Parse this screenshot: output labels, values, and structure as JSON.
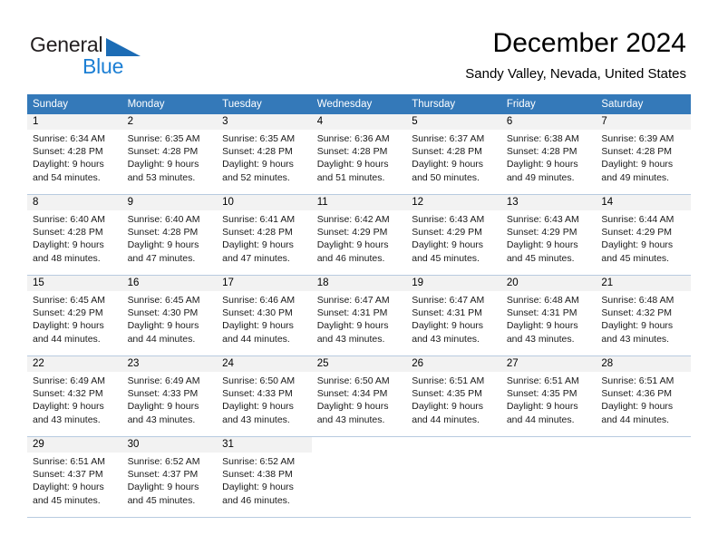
{
  "brand": {
    "name_part1": "General",
    "name_part2": "Blue",
    "triangle_icon": "triangle-icon",
    "color_dark": "#231f20",
    "color_blue": "#1c7fd4",
    "color_triangle": "#1c6cb5"
  },
  "header": {
    "month_title": "December 2024",
    "location": "Sandy Valley, Nevada, United States"
  },
  "calendar": {
    "header_bg": "#3479b9",
    "header_text_color": "#ffffff",
    "daynum_band_bg": "#f2f2f2",
    "row_border_color": "#b8cbe0",
    "weekday_headers": [
      "Sunday",
      "Monday",
      "Tuesday",
      "Wednesday",
      "Thursday",
      "Friday",
      "Saturday"
    ],
    "weeks": [
      [
        {
          "day": "1",
          "sunrise": "Sunrise: 6:34 AM",
          "sunset": "Sunset: 4:28 PM",
          "daylight_line1": "Daylight: 9 hours",
          "daylight_line2": "and 54 minutes."
        },
        {
          "day": "2",
          "sunrise": "Sunrise: 6:35 AM",
          "sunset": "Sunset: 4:28 PM",
          "daylight_line1": "Daylight: 9 hours",
          "daylight_line2": "and 53 minutes."
        },
        {
          "day": "3",
          "sunrise": "Sunrise: 6:35 AM",
          "sunset": "Sunset: 4:28 PM",
          "daylight_line1": "Daylight: 9 hours",
          "daylight_line2": "and 52 minutes."
        },
        {
          "day": "4",
          "sunrise": "Sunrise: 6:36 AM",
          "sunset": "Sunset: 4:28 PM",
          "daylight_line1": "Daylight: 9 hours",
          "daylight_line2": "and 51 minutes."
        },
        {
          "day": "5",
          "sunrise": "Sunrise: 6:37 AM",
          "sunset": "Sunset: 4:28 PM",
          "daylight_line1": "Daylight: 9 hours",
          "daylight_line2": "and 50 minutes."
        },
        {
          "day": "6",
          "sunrise": "Sunrise: 6:38 AM",
          "sunset": "Sunset: 4:28 PM",
          "daylight_line1": "Daylight: 9 hours",
          "daylight_line2": "and 49 minutes."
        },
        {
          "day": "7",
          "sunrise": "Sunrise: 6:39 AM",
          "sunset": "Sunset: 4:28 PM",
          "daylight_line1": "Daylight: 9 hours",
          "daylight_line2": "and 49 minutes."
        }
      ],
      [
        {
          "day": "8",
          "sunrise": "Sunrise: 6:40 AM",
          "sunset": "Sunset: 4:28 PM",
          "daylight_line1": "Daylight: 9 hours",
          "daylight_line2": "and 48 minutes."
        },
        {
          "day": "9",
          "sunrise": "Sunrise: 6:40 AM",
          "sunset": "Sunset: 4:28 PM",
          "daylight_line1": "Daylight: 9 hours",
          "daylight_line2": "and 47 minutes."
        },
        {
          "day": "10",
          "sunrise": "Sunrise: 6:41 AM",
          "sunset": "Sunset: 4:28 PM",
          "daylight_line1": "Daylight: 9 hours",
          "daylight_line2": "and 47 minutes."
        },
        {
          "day": "11",
          "sunrise": "Sunrise: 6:42 AM",
          "sunset": "Sunset: 4:29 PM",
          "daylight_line1": "Daylight: 9 hours",
          "daylight_line2": "and 46 minutes."
        },
        {
          "day": "12",
          "sunrise": "Sunrise: 6:43 AM",
          "sunset": "Sunset: 4:29 PM",
          "daylight_line1": "Daylight: 9 hours",
          "daylight_line2": "and 45 minutes."
        },
        {
          "day": "13",
          "sunrise": "Sunrise: 6:43 AM",
          "sunset": "Sunset: 4:29 PM",
          "daylight_line1": "Daylight: 9 hours",
          "daylight_line2": "and 45 minutes."
        },
        {
          "day": "14",
          "sunrise": "Sunrise: 6:44 AM",
          "sunset": "Sunset: 4:29 PM",
          "daylight_line1": "Daylight: 9 hours",
          "daylight_line2": "and 45 minutes."
        }
      ],
      [
        {
          "day": "15",
          "sunrise": "Sunrise: 6:45 AM",
          "sunset": "Sunset: 4:29 PM",
          "daylight_line1": "Daylight: 9 hours",
          "daylight_line2": "and 44 minutes."
        },
        {
          "day": "16",
          "sunrise": "Sunrise: 6:45 AM",
          "sunset": "Sunset: 4:30 PM",
          "daylight_line1": "Daylight: 9 hours",
          "daylight_line2": "and 44 minutes."
        },
        {
          "day": "17",
          "sunrise": "Sunrise: 6:46 AM",
          "sunset": "Sunset: 4:30 PM",
          "daylight_line1": "Daylight: 9 hours",
          "daylight_line2": "and 44 minutes."
        },
        {
          "day": "18",
          "sunrise": "Sunrise: 6:47 AM",
          "sunset": "Sunset: 4:31 PM",
          "daylight_line1": "Daylight: 9 hours",
          "daylight_line2": "and 43 minutes."
        },
        {
          "day": "19",
          "sunrise": "Sunrise: 6:47 AM",
          "sunset": "Sunset: 4:31 PM",
          "daylight_line1": "Daylight: 9 hours",
          "daylight_line2": "and 43 minutes."
        },
        {
          "day": "20",
          "sunrise": "Sunrise: 6:48 AM",
          "sunset": "Sunset: 4:31 PM",
          "daylight_line1": "Daylight: 9 hours",
          "daylight_line2": "and 43 minutes."
        },
        {
          "day": "21",
          "sunrise": "Sunrise: 6:48 AM",
          "sunset": "Sunset: 4:32 PM",
          "daylight_line1": "Daylight: 9 hours",
          "daylight_line2": "and 43 minutes."
        }
      ],
      [
        {
          "day": "22",
          "sunrise": "Sunrise: 6:49 AM",
          "sunset": "Sunset: 4:32 PM",
          "daylight_line1": "Daylight: 9 hours",
          "daylight_line2": "and 43 minutes."
        },
        {
          "day": "23",
          "sunrise": "Sunrise: 6:49 AM",
          "sunset": "Sunset: 4:33 PM",
          "daylight_line1": "Daylight: 9 hours",
          "daylight_line2": "and 43 minutes."
        },
        {
          "day": "24",
          "sunrise": "Sunrise: 6:50 AM",
          "sunset": "Sunset: 4:33 PM",
          "daylight_line1": "Daylight: 9 hours",
          "daylight_line2": "and 43 minutes."
        },
        {
          "day": "25",
          "sunrise": "Sunrise: 6:50 AM",
          "sunset": "Sunset: 4:34 PM",
          "daylight_line1": "Daylight: 9 hours",
          "daylight_line2": "and 43 minutes."
        },
        {
          "day": "26",
          "sunrise": "Sunrise: 6:51 AM",
          "sunset": "Sunset: 4:35 PM",
          "daylight_line1": "Daylight: 9 hours",
          "daylight_line2": "and 44 minutes."
        },
        {
          "day": "27",
          "sunrise": "Sunrise: 6:51 AM",
          "sunset": "Sunset: 4:35 PM",
          "daylight_line1": "Daylight: 9 hours",
          "daylight_line2": "and 44 minutes."
        },
        {
          "day": "28",
          "sunrise": "Sunrise: 6:51 AM",
          "sunset": "Sunset: 4:36 PM",
          "daylight_line1": "Daylight: 9 hours",
          "daylight_line2": "and 44 minutes."
        }
      ],
      [
        {
          "day": "29",
          "sunrise": "Sunrise: 6:51 AM",
          "sunset": "Sunset: 4:37 PM",
          "daylight_line1": "Daylight: 9 hours",
          "daylight_line2": "and 45 minutes."
        },
        {
          "day": "30",
          "sunrise": "Sunrise: 6:52 AM",
          "sunset": "Sunset: 4:37 PM",
          "daylight_line1": "Daylight: 9 hours",
          "daylight_line2": "and 45 minutes."
        },
        {
          "day": "31",
          "sunrise": "Sunrise: 6:52 AM",
          "sunset": "Sunset: 4:38 PM",
          "daylight_line1": "Daylight: 9 hours",
          "daylight_line2": "and 46 minutes."
        },
        {
          "day": "",
          "sunrise": "",
          "sunset": "",
          "daylight_line1": "",
          "daylight_line2": ""
        },
        {
          "day": "",
          "sunrise": "",
          "sunset": "",
          "daylight_line1": "",
          "daylight_line2": ""
        },
        {
          "day": "",
          "sunrise": "",
          "sunset": "",
          "daylight_line1": "",
          "daylight_line2": ""
        },
        {
          "day": "",
          "sunrise": "",
          "sunset": "",
          "daylight_line1": "",
          "daylight_line2": ""
        }
      ]
    ]
  }
}
